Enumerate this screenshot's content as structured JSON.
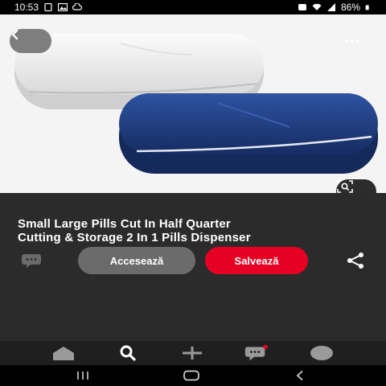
{
  "status_bar": {
    "time": "10:53",
    "battery": "86%",
    "icons": [
      "sim-icon",
      "image-icon",
      "cloud-icon",
      "alarm-icon",
      "wifi-icon",
      "signal-icon",
      "battery-icon"
    ]
  },
  "hero": {
    "icons": [
      "back-arrow-icon",
      "more-dots-icon",
      "visual-search-icon"
    ]
  },
  "pin": {
    "title_line1": "Small Large Pills Cut In Half Quarter",
    "title_line2": "Cutting & Storage 2 In 1 Pills Dispenser"
  },
  "actions": {
    "visit_label": "Accesează",
    "save_label": "Salvează",
    "icons": [
      "comment-icon",
      "share-icon"
    ]
  },
  "colors": {
    "save": "#e60023",
    "visit": "#6b6b6b",
    "background": "#2b2b2b",
    "pill_white": "#e9e9e9",
    "pill_blue": "#1f3f86"
  },
  "bottom_nav": {
    "icons": [
      "home-icon",
      "search-icon",
      "create-plus-icon",
      "messages-icon",
      "profile-avatar-icon"
    ],
    "messages_badge": "#e60023"
  },
  "system_nav": {
    "icons": [
      "recents-icon",
      "home-circle-icon",
      "back-chevron-icon"
    ]
  }
}
